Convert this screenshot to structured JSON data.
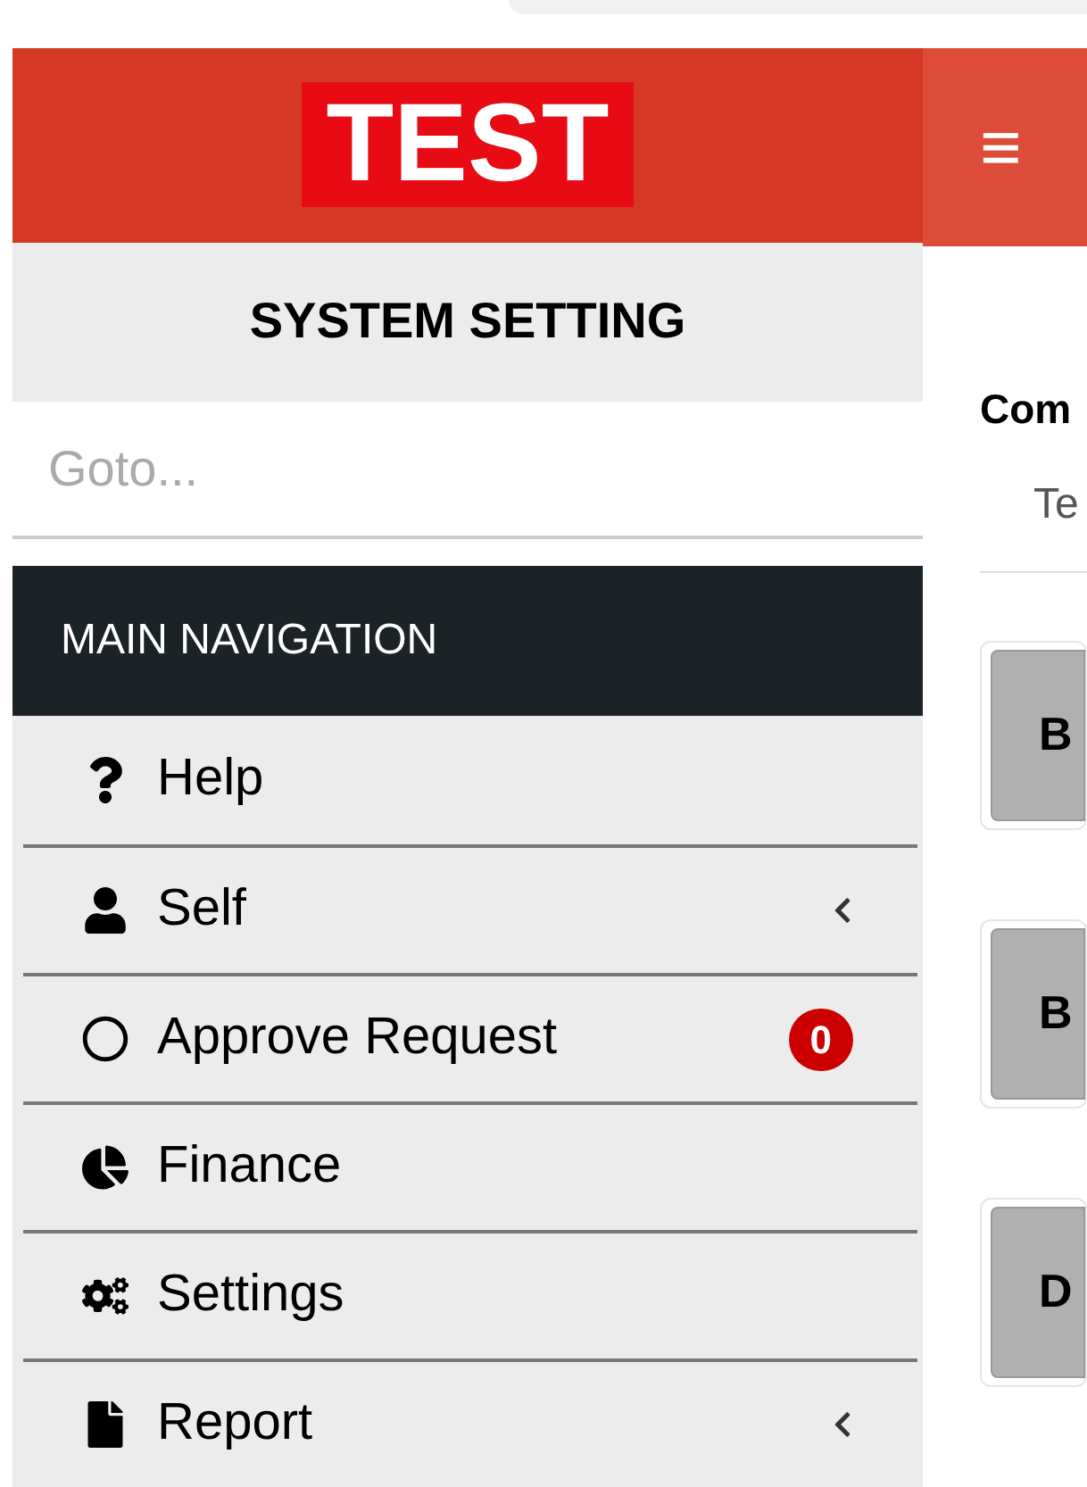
{
  "logo": "TEST",
  "menu_toggle": "≡",
  "sidebar": {
    "title": "SYSTEM SETTING",
    "search": {
      "placeholder": "Goto..."
    },
    "section": "MAIN NAVIGATION",
    "items": [
      {
        "label": "Help",
        "kind": "help",
        "expandable": false
      },
      {
        "label": "Self",
        "kind": "user",
        "expandable": true
      },
      {
        "label": "Approve Request",
        "kind": "approval",
        "expandable": false,
        "badge": "0"
      },
      {
        "label": "Finance",
        "kind": "finance",
        "expandable": false
      },
      {
        "label": "Settings",
        "kind": "settings",
        "expandable": false
      },
      {
        "label": "Report",
        "kind": "report",
        "expandable": true
      }
    ]
  },
  "content": {
    "heading": "Com",
    "tab": "Te",
    "buttons": [
      "B",
      "B",
      "D"
    ]
  }
}
